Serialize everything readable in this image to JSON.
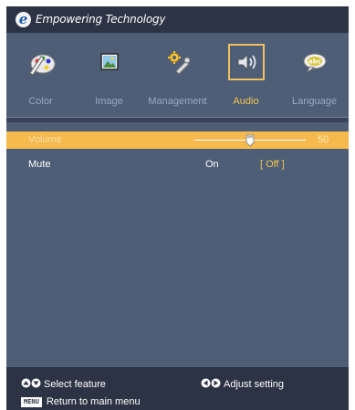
{
  "brand": {
    "logo_letter": "e",
    "tagline": "Empowering Technology"
  },
  "tabs": [
    {
      "label": "Color",
      "icon": "color-palette-icon",
      "active": false
    },
    {
      "label": "Image",
      "icon": "image-picture-icon",
      "active": false
    },
    {
      "label": "Management",
      "icon": "management-tools-icon",
      "active": false
    },
    {
      "label": "Audio",
      "icon": "speaker-icon",
      "active": true
    },
    {
      "label": "Language",
      "icon": "language-abc-icon",
      "active": false
    }
  ],
  "settings": {
    "volume": {
      "label": "Volume",
      "value": "50",
      "level_percent": 50
    },
    "mute": {
      "label": "Mute",
      "option_on": "On",
      "option_off": "[ Off ]",
      "selected": "Off"
    }
  },
  "footer": {
    "select_feature": "Select feature",
    "adjust_setting": "Adjust setting",
    "menu_key": "MENU",
    "return_menu": "Return to main menu"
  },
  "colors": {
    "osd_background": "#4e5e77",
    "header_footer": "#2c3344",
    "highlight": "#f5b94d",
    "active_label": "#f4c451"
  }
}
